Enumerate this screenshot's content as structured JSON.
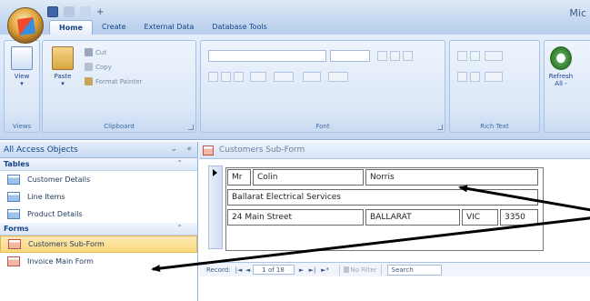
{
  "app": {
    "title": "Mic"
  },
  "quick_access": {
    "icons": [
      "save-icon",
      "undo-icon",
      "redo-icon",
      "customize-icon"
    ],
    "separator": "+"
  },
  "tabs": [
    {
      "label": "Home",
      "active": true
    },
    {
      "label": "Create",
      "active": false
    },
    {
      "label": "External Data",
      "active": false
    },
    {
      "label": "Database Tools",
      "active": false
    }
  ],
  "ribbon": {
    "views": {
      "view_label": "View",
      "group_label": "Views"
    },
    "clipboard": {
      "paste_label": "Paste",
      "cut_label": "Cut",
      "copy_label": "Copy",
      "format_painter_label": "Format Painter",
      "group_label": "Clipboard"
    },
    "font": {
      "group_label": "Font"
    },
    "rich_text": {
      "group_label": "Rich Text"
    },
    "records": {
      "refresh_label": "Refresh",
      "refresh_sub": "All -"
    }
  },
  "nav_pane": {
    "header": "All Access Objects",
    "header_controls": [
      "⌄",
      "«"
    ],
    "groups": [
      {
        "label": "Tables",
        "chevron": "⌃",
        "items": [
          {
            "label": "Customer Details",
            "selected": false
          },
          {
            "label": "Line Items",
            "selected": false
          },
          {
            "label": "Product Details",
            "selected": false
          }
        ]
      },
      {
        "label": "Forms",
        "chevron": "⌃",
        "items": [
          {
            "label": "Customers Sub-Form",
            "selected": true
          },
          {
            "label": "Invoice Main Form",
            "selected": false
          }
        ]
      }
    ]
  },
  "document": {
    "tab_title": "Customers Sub-Form",
    "fields": {
      "title": "Mr",
      "first_name": "Colin",
      "surname": "Norris",
      "company": "Ballarat Electrical Services",
      "street": "24 Main Street",
      "city": "BALLARAT",
      "state": "VIC",
      "postcode": "3350"
    },
    "record_nav": {
      "label": "Record:",
      "first": "|◄",
      "prev": "◄",
      "position": "1 of 18",
      "next": "►",
      "last": "►|",
      "new": "►*",
      "filter_label": "No Filter",
      "search_label": "Search"
    }
  },
  "colors": {
    "ribbon_bg": "#d1e1f6",
    "selected_item": "#fbd97d",
    "annotation_arrow": "#000000"
  }
}
